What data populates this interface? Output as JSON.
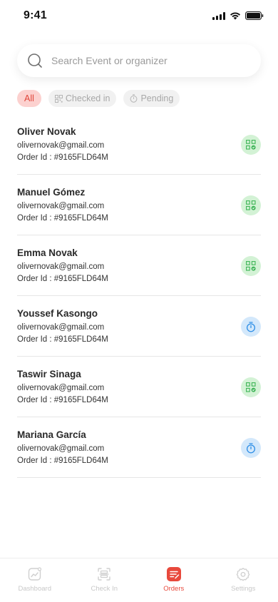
{
  "status": {
    "time": "9:41"
  },
  "search": {
    "placeholder": "Search Event or organizer"
  },
  "filters": [
    {
      "label": "All"
    },
    {
      "label": "Checked in"
    },
    {
      "label": "Pending"
    }
  ],
  "orders": [
    {
      "name": "Oliver Novak",
      "email": "olivernovak@gmail.com",
      "order": "Order Id : #9165FLD64M",
      "status": "checked-in"
    },
    {
      "name": "Manuel Gómez",
      "email": "olivernovak@gmail.com",
      "order": "Order Id : #9165FLD64M",
      "status": "checked-in"
    },
    {
      "name": "Emma Novak",
      "email": "olivernovak@gmail.com",
      "order": "Order Id : #9165FLD64M",
      "status": "checked-in"
    },
    {
      "name": "Youssef Kasongo",
      "email": "olivernovak@gmail.com",
      "order": "Order Id : #9165FLD64M",
      "status": "pending"
    },
    {
      "name": "Taswir Sinaga",
      "email": "olivernovak@gmail.com",
      "order": "Order Id : #9165FLD64M",
      "status": "checked-in"
    },
    {
      "name": "Mariana García",
      "email": "olivernovak@gmail.com",
      "order": "Order Id : #9165FLD64M",
      "status": "pending"
    }
  ],
  "tabs": [
    {
      "label": "Dashboard",
      "icon": "dashboard-icon"
    },
    {
      "label": "Check In",
      "icon": "scan-icon"
    },
    {
      "label": "Orders",
      "icon": "orders-icon"
    },
    {
      "label": "Settings",
      "icon": "settings-icon"
    }
  ],
  "colors": {
    "accent": "#e8493c",
    "checked_bg": "#d3f2d5",
    "checked_fg": "#3cb455",
    "pending_bg": "#d3e8fb",
    "pending_fg": "#2d8ee6"
  }
}
